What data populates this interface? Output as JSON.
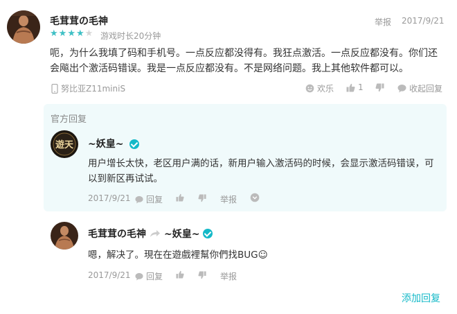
{
  "review": {
    "username": "毛茸茸の毛神",
    "report_label": "举报",
    "date": "2017/9/21",
    "rating": 4,
    "rating_max": 5,
    "playtime": "游戏时长20分钟",
    "content": "呃，为什么我填了码和手机号。一点反应都没得有。我狂点激活。一点反应都没有。你们还会飚出个激活码错误。我是一点反应都没有。不是网络问题。我上其他软件都可以。",
    "device": "努比亚Z11miniS",
    "actions": {
      "fun_label": "欢乐",
      "like_count": "1",
      "collapse_label": "收起回复"
    }
  },
  "official_reply": {
    "section_label": "官方回复",
    "username": "~妖皇~",
    "avatar_text": "遊天",
    "content": "用户增长太快，老区用户满的话，新用户输入激活码的时候，会显示激活码错误，可以到新区再试试。",
    "date": "2017/9/21",
    "reply_label": "回复",
    "report_label": "举报"
  },
  "user_reply": {
    "username": "毛茸茸の毛神",
    "target_username": "~妖皇~",
    "content": "嗯，解决了。現在在遊戲裡幫你們找BUG☺",
    "date": "2017/9/21",
    "reply_label": "回复",
    "report_label": "举报"
  },
  "footer": {
    "add_reply_label": "添加回复"
  },
  "colors": {
    "accent": "#14b9c8",
    "star": "#3fc0c5",
    "official_bg": "#f0fafb"
  }
}
